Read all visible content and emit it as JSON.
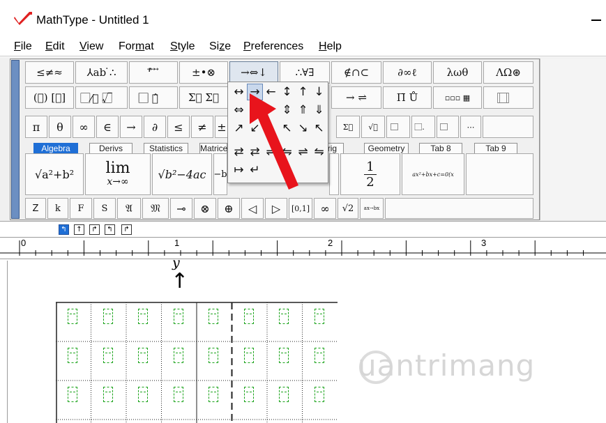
{
  "window": {
    "title": "MathType - Untitled 1",
    "app_logo": "mathtype-logo-icon",
    "accent": "#e02020"
  },
  "menu": [
    {
      "u": "F",
      "rest": "ile"
    },
    {
      "u": "E",
      "rest": "dit"
    },
    {
      "u": "V",
      "rest": "iew"
    },
    {
      "pre": "For",
      "u": "m",
      "rest": "at"
    },
    {
      "u": "S",
      "rest": "tyle"
    },
    {
      "pre": "Si",
      "u": "z",
      "rest": "e"
    },
    {
      "u": "P",
      "rest": "references"
    },
    {
      "u": "H",
      "rest": "elp"
    }
  ],
  "palette_row1": [
    "≤≠≈",
    "⅄ab ̇∴",
    "⸢⃗ ⃗ ⃗ ",
    "±•⊗",
    "→⇔↓",
    "∴∀∃",
    "∉∩⊂",
    "∂∞ℓ",
    "λωθ",
    "ΛΩ⊛"
  ],
  "palette_row2": [
    "(⃞) [⃞]",
    "⃞⁄⃞ √⃞",
    "⃞⃞ ⃞̂",
    "Σ⃞ Σ⃞",
    "→ ⇄",
    "→ ⇌",
    "Π̄ Ů",
    "▫▫▫ ▦",
    "⃞ ⃞"
  ],
  "symbols_row": [
    "π",
    "θ",
    "∞",
    "∈",
    "→",
    "∂",
    "≤",
    "≠",
    "±",
    "",
    "",
    "",
    "",
    "",
    "",
    "",
    "",
    "Σ⃞",
    "√⃞",
    "⃞⃞",
    "⃞.",
    "⃞⃞",
    "⋯"
  ],
  "tabs": [
    "Algebra",
    "Derivs",
    "Statistics",
    "Matrices",
    "Trig",
    "Geometry",
    "Tab 8",
    "Tab 9"
  ],
  "templates": {
    "sqrt_sum": "√a²+b²",
    "lim_word": "lim",
    "lim_sub": "x→∞",
    "discriminant": "√b²−4ac",
    "partial": "−b",
    "half_num": "1",
    "half_den": "2",
    "quadratic": "ax²+bx+c=0(x"
  },
  "bottom_row": [
    "Z",
    "k",
    "F",
    "S",
    "𝔄",
    "𝔐",
    "⊸",
    "⊗",
    "⊕",
    "◁",
    "▷",
    "[0,1]",
    "∞",
    "√2",
    "ax→bx"
  ],
  "arrow_menu": {
    "rows": [
      [
        "↔",
        "→",
        "←",
        "↕",
        "↑",
        "↓"
      ],
      [
        "⇔",
        "",
        "",
        "⇕",
        "⇑",
        "⇓"
      ],
      [
        "↗",
        "↙",
        "",
        "↖",
        "↘",
        "↖"
      ],
      [
        "⇄",
        "⇄",
        "⇌",
        "⇋",
        "⇌",
        "⇋"
      ],
      [
        "↦",
        "↵",
        "",
        "",
        "",
        ""
      ]
    ],
    "highlighted": "→"
  },
  "tiny_buttons": [
    "↰",
    "↑",
    "↱",
    "↰",
    "↱"
  ],
  "ruler": {
    "marks": [
      "0",
      "1",
      "2",
      "3"
    ]
  },
  "editor": {
    "top_symbol": "y",
    "arrow_symbol": "↑"
  },
  "watermark": "uantrimang"
}
